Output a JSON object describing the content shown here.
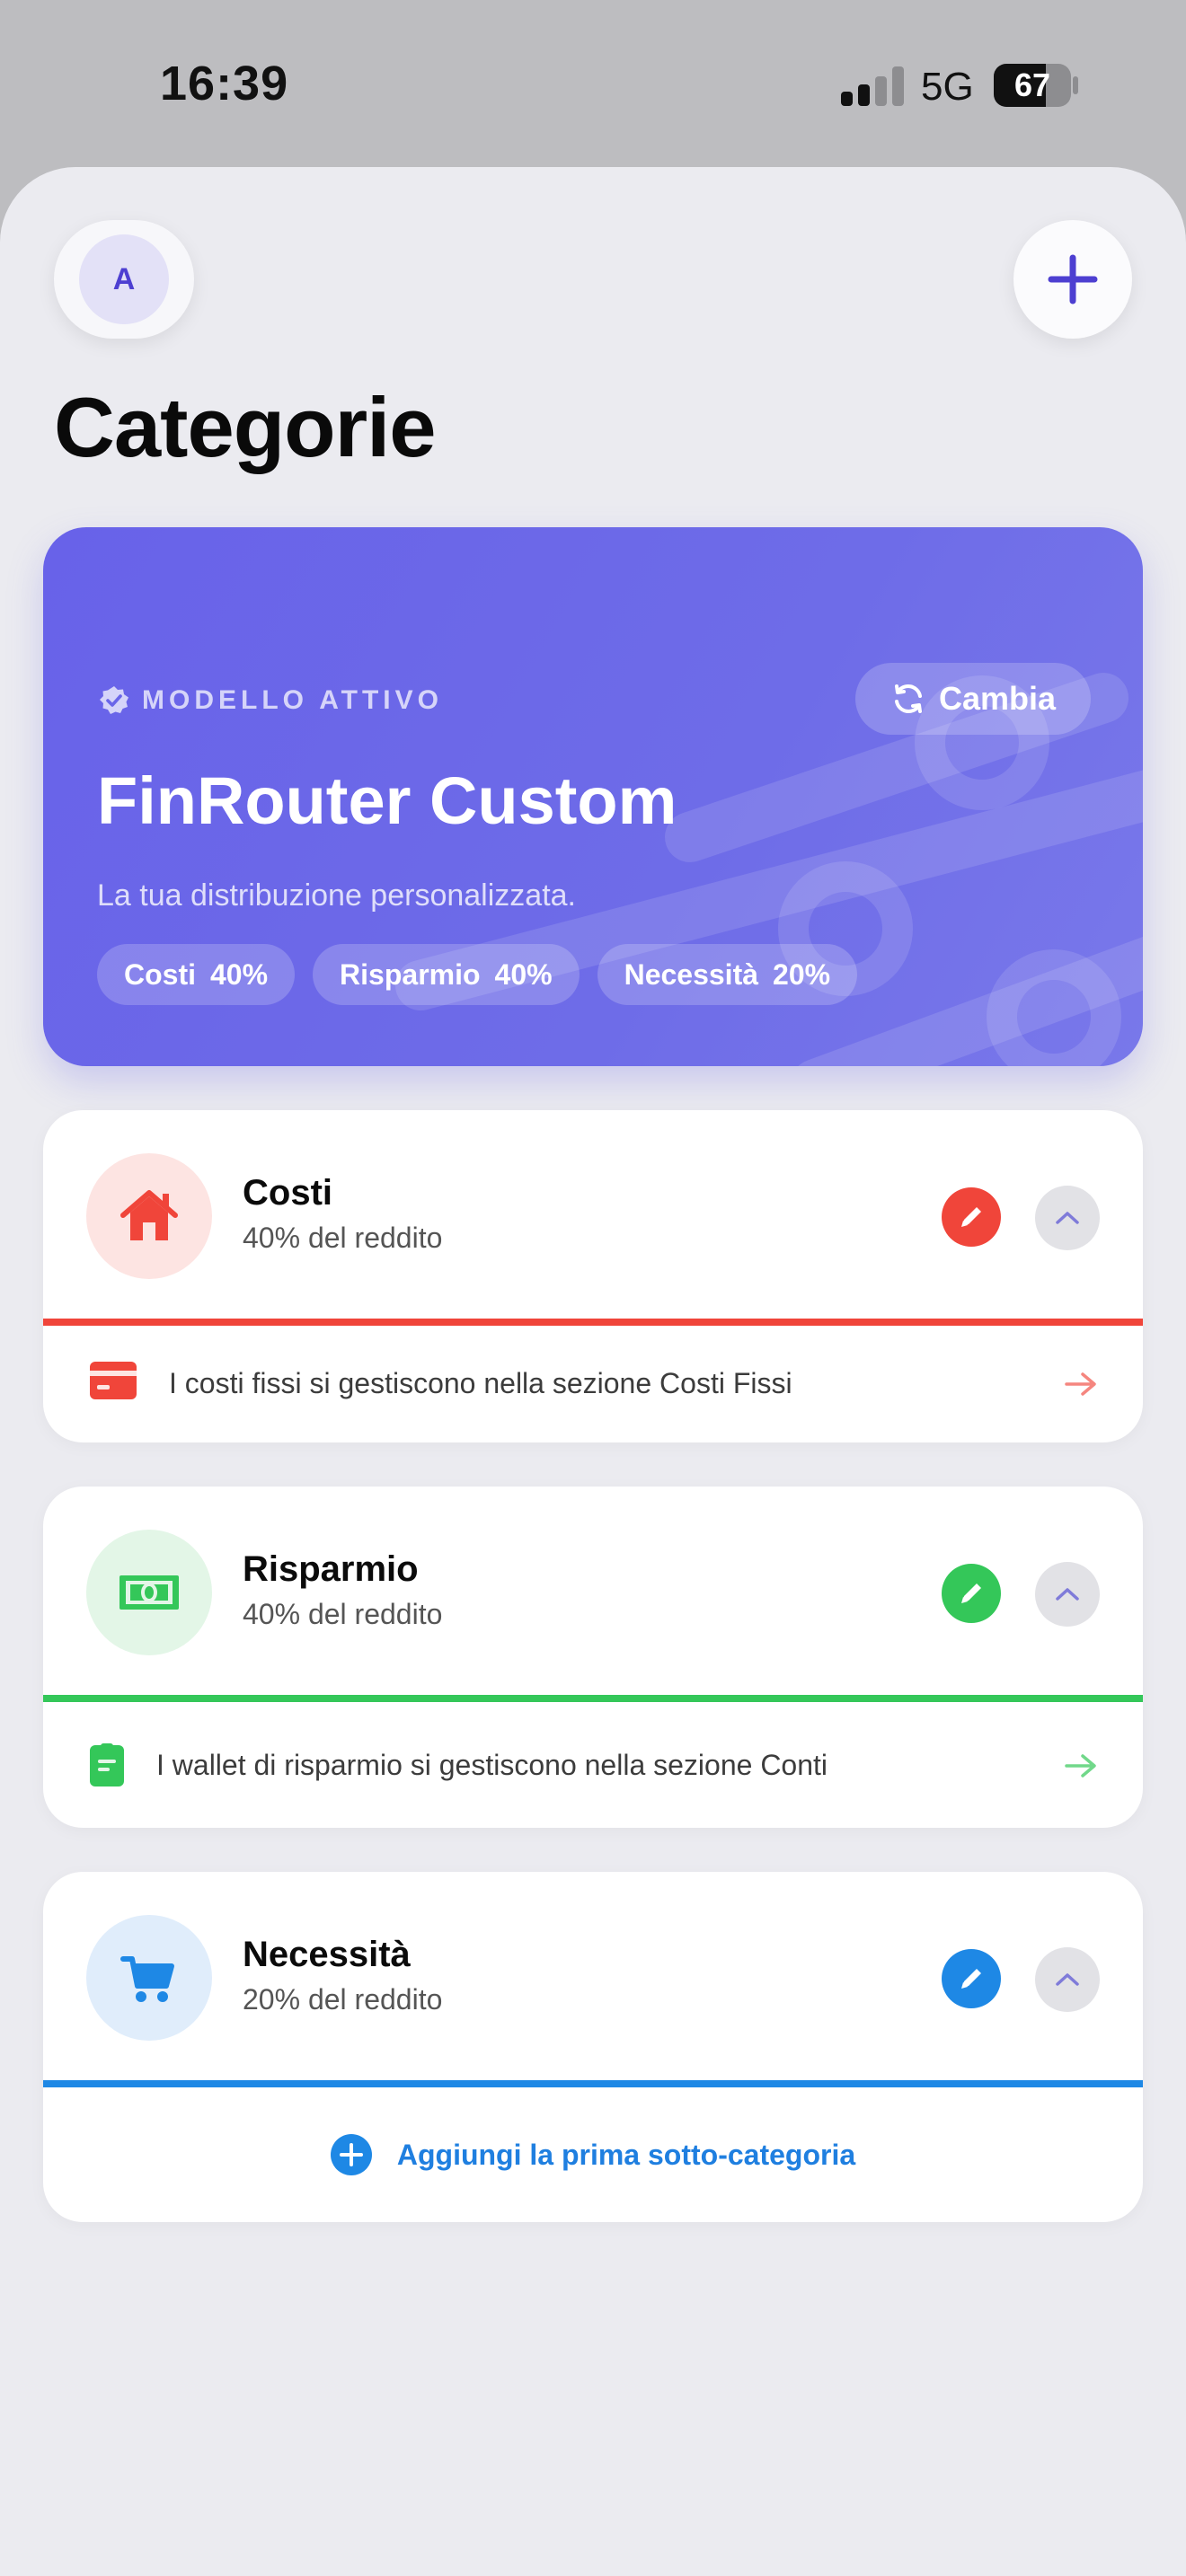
{
  "status": {
    "time": "16:39",
    "network": "5G",
    "battery": "67",
    "battery_level": 0.67
  },
  "header": {
    "avatar_initial": "A",
    "title": "Categorie"
  },
  "hero": {
    "eyebrow": "MODELLO ATTIVO",
    "change_label": "Cambia",
    "title": "FinRouter Custom",
    "subtitle": "La tua distribuzione personalizzata.",
    "chips": [
      {
        "label": "Costi",
        "pct": "40%"
      },
      {
        "label": "Risparmio",
        "pct": "40%"
      },
      {
        "label": "Necessità",
        "pct": "20%"
      }
    ]
  },
  "categories": [
    {
      "name": "Costi",
      "share": "40% del reddito",
      "icon": "house-icon",
      "color": "#f0453a",
      "soft": "#fde4e2",
      "footer": "I costi fissi si gestiscono nella sezione Costi Fissi",
      "footer_icon": "credit-card-icon"
    },
    {
      "name": "Risparmio",
      "share": "40% del reddito",
      "icon": "banknote-icon",
      "color": "#34c759",
      "soft": "#e3f6e7",
      "footer": "I wallet di risparmio si gestiscono nella sezione Conti",
      "footer_icon": "wallet-card-icon"
    },
    {
      "name": "Necessità",
      "share": "20% del reddito",
      "icon": "cart-icon",
      "color": "#1e88e5",
      "soft": "#e0edfb",
      "footer": "Aggiungi la prima sotto-categoria",
      "footer_icon": "plus-circle-icon"
    }
  ]
}
